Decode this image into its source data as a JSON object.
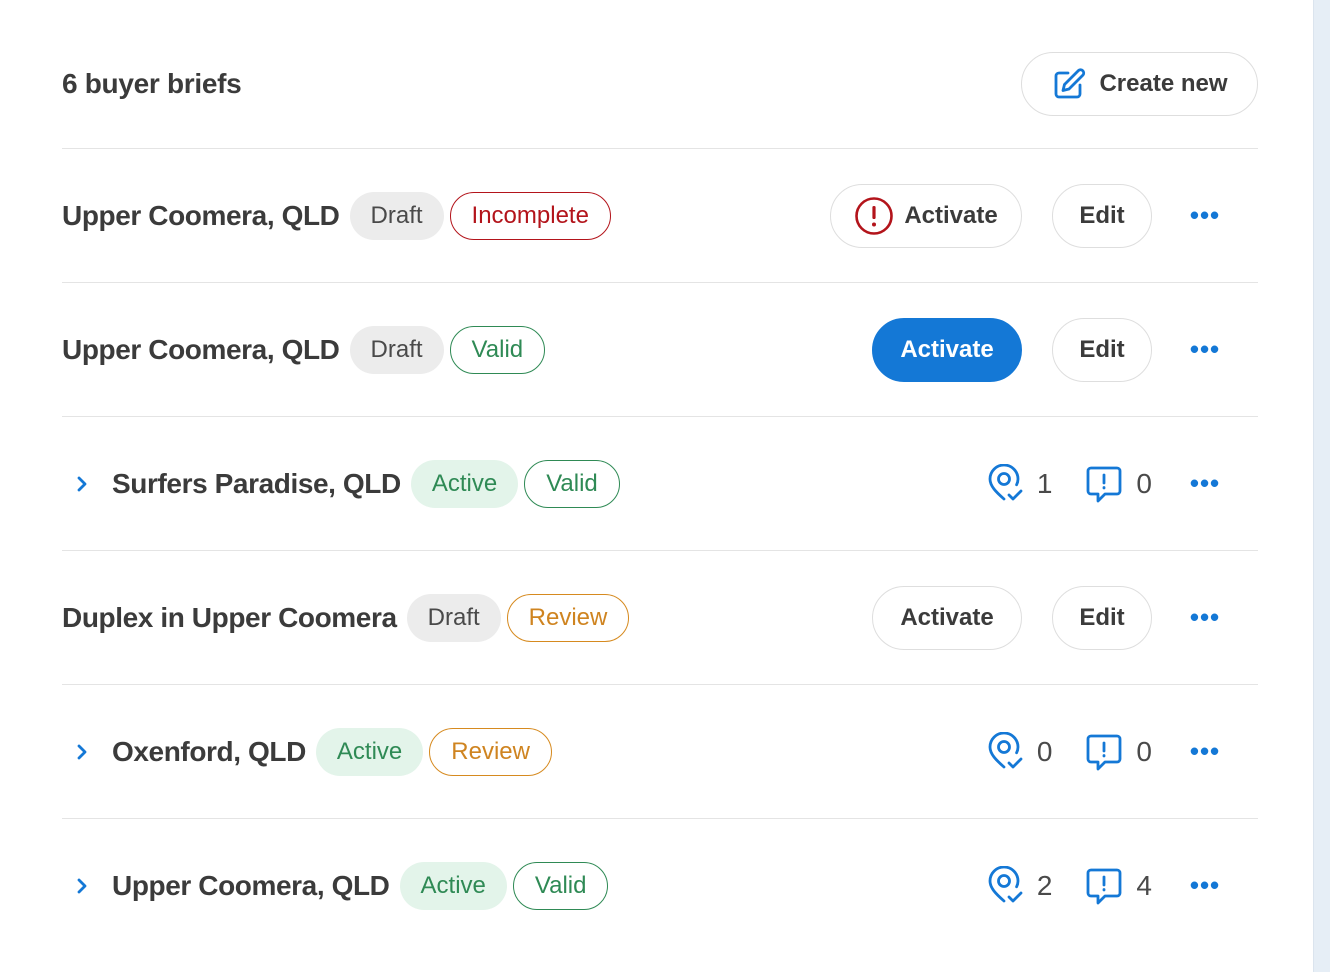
{
  "header": {
    "title": "6 buyer briefs",
    "create_label": "Create new"
  },
  "colors": {
    "accent": "#1478d6",
    "error": "#b3141b",
    "success": "#2f8a55",
    "warning": "#cf8420"
  },
  "labels": {
    "activate": "Activate",
    "edit": "Edit",
    "more": "•••"
  },
  "briefs": [
    {
      "title": "Upper Coomera, QLD",
      "status": "Draft",
      "validity": "Incomplete",
      "expandable": false,
      "activate_warning": true
    },
    {
      "title": "Upper Coomera, QLD",
      "status": "Draft",
      "validity": "Valid",
      "expandable": false,
      "activate_primary": true
    },
    {
      "title": "Surfers Paradise, QLD",
      "status": "Active",
      "validity": "Valid",
      "expandable": true,
      "matches": "1",
      "enquiries": "0"
    },
    {
      "title": "Duplex in Upper Coomera",
      "status": "Draft",
      "validity": "Review",
      "expandable": false
    },
    {
      "title": "Oxenford, QLD",
      "status": "Active",
      "validity": "Review",
      "expandable": true,
      "matches": "0",
      "enquiries": "0"
    },
    {
      "title": "Upper Coomera, QLD",
      "status": "Active",
      "validity": "Valid",
      "expandable": true,
      "matches": "2",
      "enquiries": "4"
    }
  ]
}
